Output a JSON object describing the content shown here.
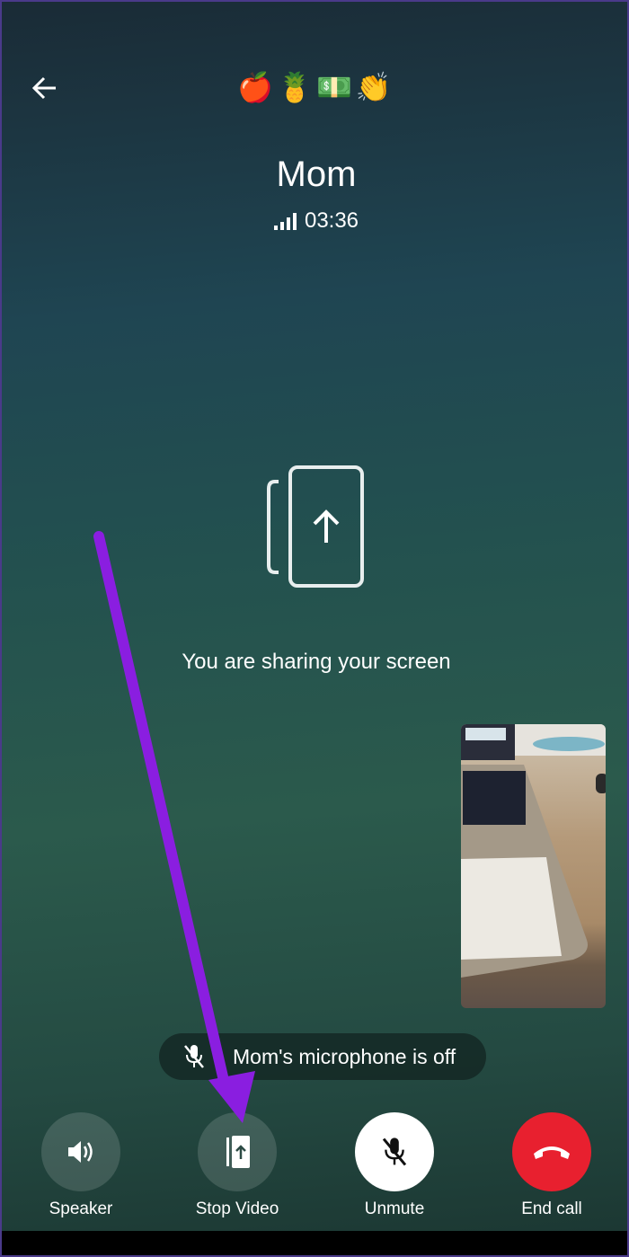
{
  "header": {
    "emojis": "🍎🍍💵👏",
    "contact_name": "Mom",
    "call_duration": "03:36"
  },
  "main": {
    "sharing_message": "You are sharing your screen"
  },
  "toast": {
    "text": "Mom's microphone is off"
  },
  "controls": [
    {
      "label": "Speaker",
      "icon": "speaker-icon"
    },
    {
      "label": "Stop Video",
      "icon": "screen-share-icon"
    },
    {
      "label": "Unmute",
      "icon": "mic-off-icon"
    },
    {
      "label": "End call",
      "icon": "end-call-icon"
    }
  ],
  "colors": {
    "end_call": "#e8202f",
    "unmute_bg": "#ffffff",
    "annotation_arrow": "#8a1ee0"
  }
}
